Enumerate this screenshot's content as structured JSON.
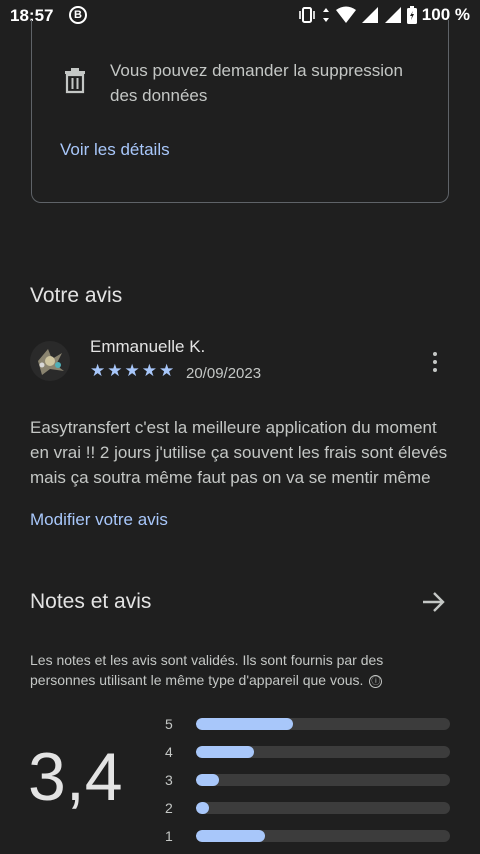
{
  "status_bar": {
    "time": "18:57",
    "b_badge": "B",
    "battery": "100 %"
  },
  "data_safety": {
    "deletion_text": "Vous pouvez demander la suppression des données",
    "details_link": "Voir les détails"
  },
  "your_review": {
    "title": "Votre avis",
    "reviewer": "Emmanuelle K.",
    "stars": "★★★★★",
    "rating": 5,
    "date": "20/09/2023",
    "text": "Easytransfert c'est la meilleure application du moment en vrai !! 2 jours j'utilise ça souvent les frais sont élevés mais ça soutra même faut pas on va se mentir même",
    "edit_link": "Modifier votre avis"
  },
  "ratings": {
    "title": "Notes et avis",
    "info": "Les notes et les avis sont validés. Ils sont fournis par des personnes utilisant le même type d'appareil que vous.",
    "info_icon": "ⓘ",
    "average": "3,4",
    "distribution": [
      {
        "label": "5",
        "fraction": 0.38
      },
      {
        "label": "4",
        "fraction": 0.23
      },
      {
        "label": "3",
        "fraction": 0.09
      },
      {
        "label": "2",
        "fraction": 0.05
      },
      {
        "label": "1",
        "fraction": 0.27
      }
    ]
  },
  "colors": {
    "accent": "#a8c7fa",
    "background": "#1f1f1f",
    "text": "#e3e3e3"
  }
}
